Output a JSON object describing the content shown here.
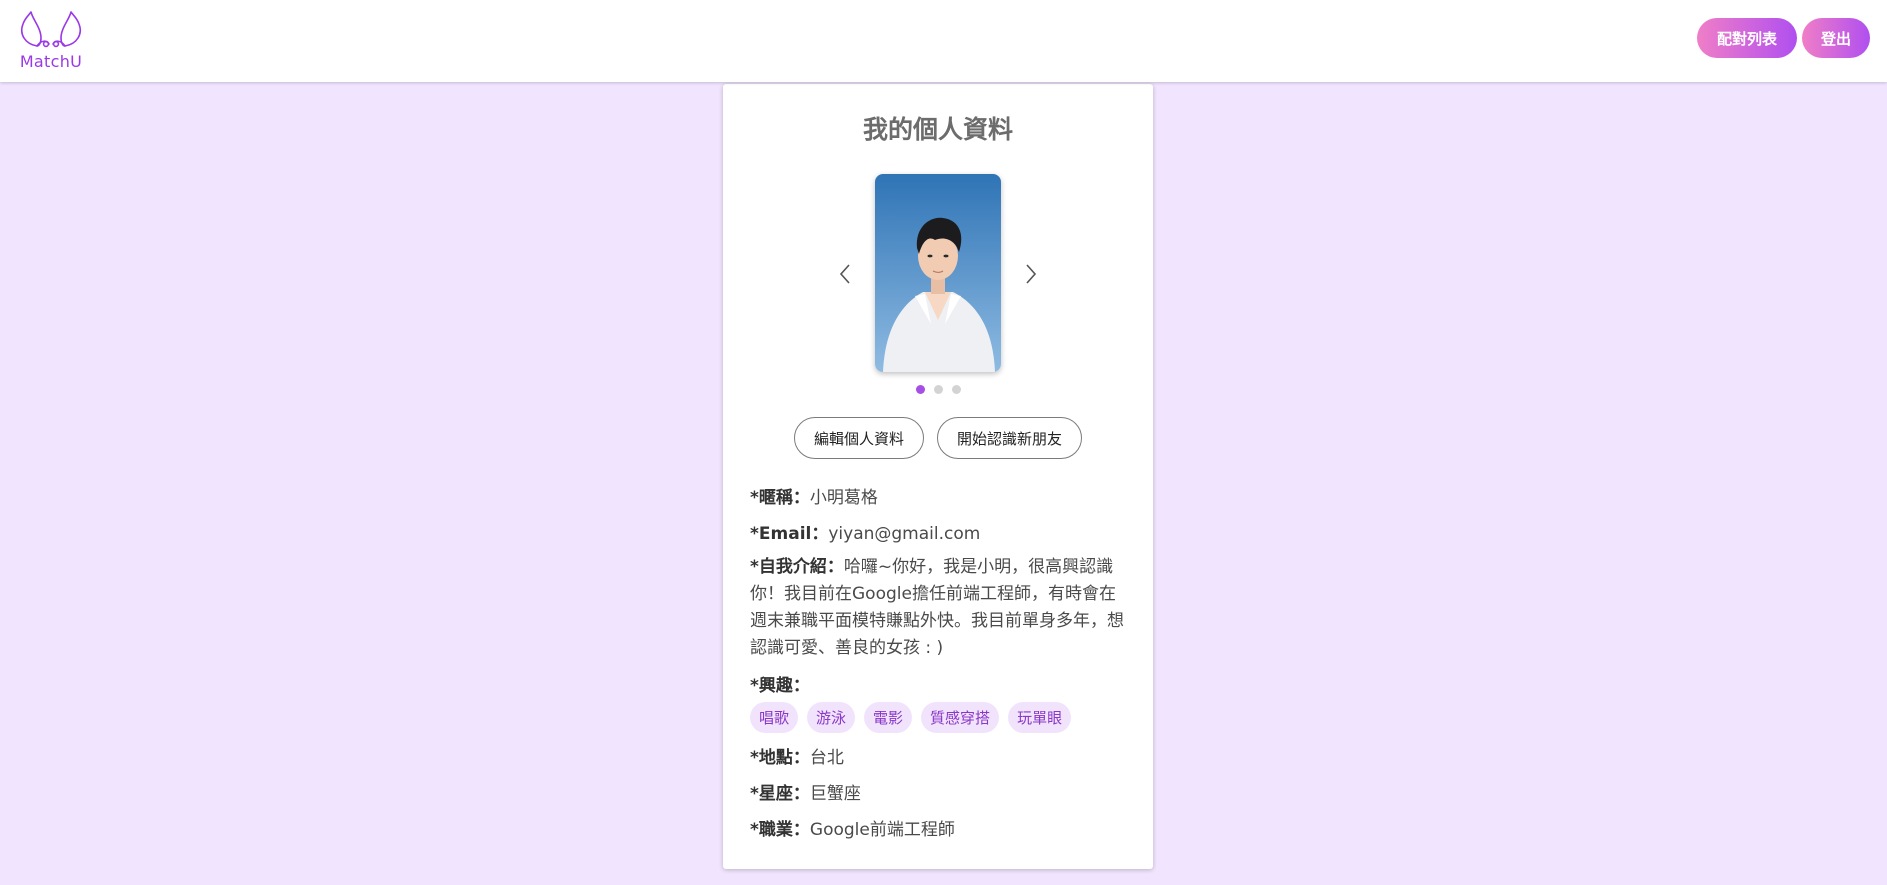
{
  "app": {
    "brand": "MatchU",
    "brand_color": "#9a39e8",
    "background_color": "#f1e4fe"
  },
  "nav": {
    "match_list_label": "配對列表",
    "logout_label": "登出"
  },
  "profile": {
    "title": "我的個人資料",
    "carousel": {
      "photo_count": 3,
      "active_index": 0,
      "prev_icon": "chevron-left-icon",
      "next_icon": "chevron-right-icon"
    },
    "buttons": {
      "edit_label": "編輯個人資料",
      "discover_label": "開始認識新朋友"
    },
    "fields": {
      "nickname_label": "*暱稱：",
      "nickname_value": "小明葛格",
      "email_label": "*Email：",
      "email_value": "yiyan@gmail.com",
      "intro_label": "*自我介紹：",
      "intro_value": "哈囉~你好，我是小明，很高興認識你！我目前在Google擔任前端工程師，有時會在週末兼職平面模特賺點外快。我目前單身多年，想認識可愛、善良的女孩 : )",
      "hobbies_label": "*興趣：",
      "hobbies": [
        "唱歌",
        "游泳",
        "電影",
        "質感穿搭",
        "玩單眼"
      ],
      "location_label": "*地點：",
      "location_value": "台北",
      "zodiac_label": "*星座：",
      "zodiac_value": "巨蟹座",
      "job_label": "*職業：",
      "job_value": "Google前端工程師"
    }
  }
}
